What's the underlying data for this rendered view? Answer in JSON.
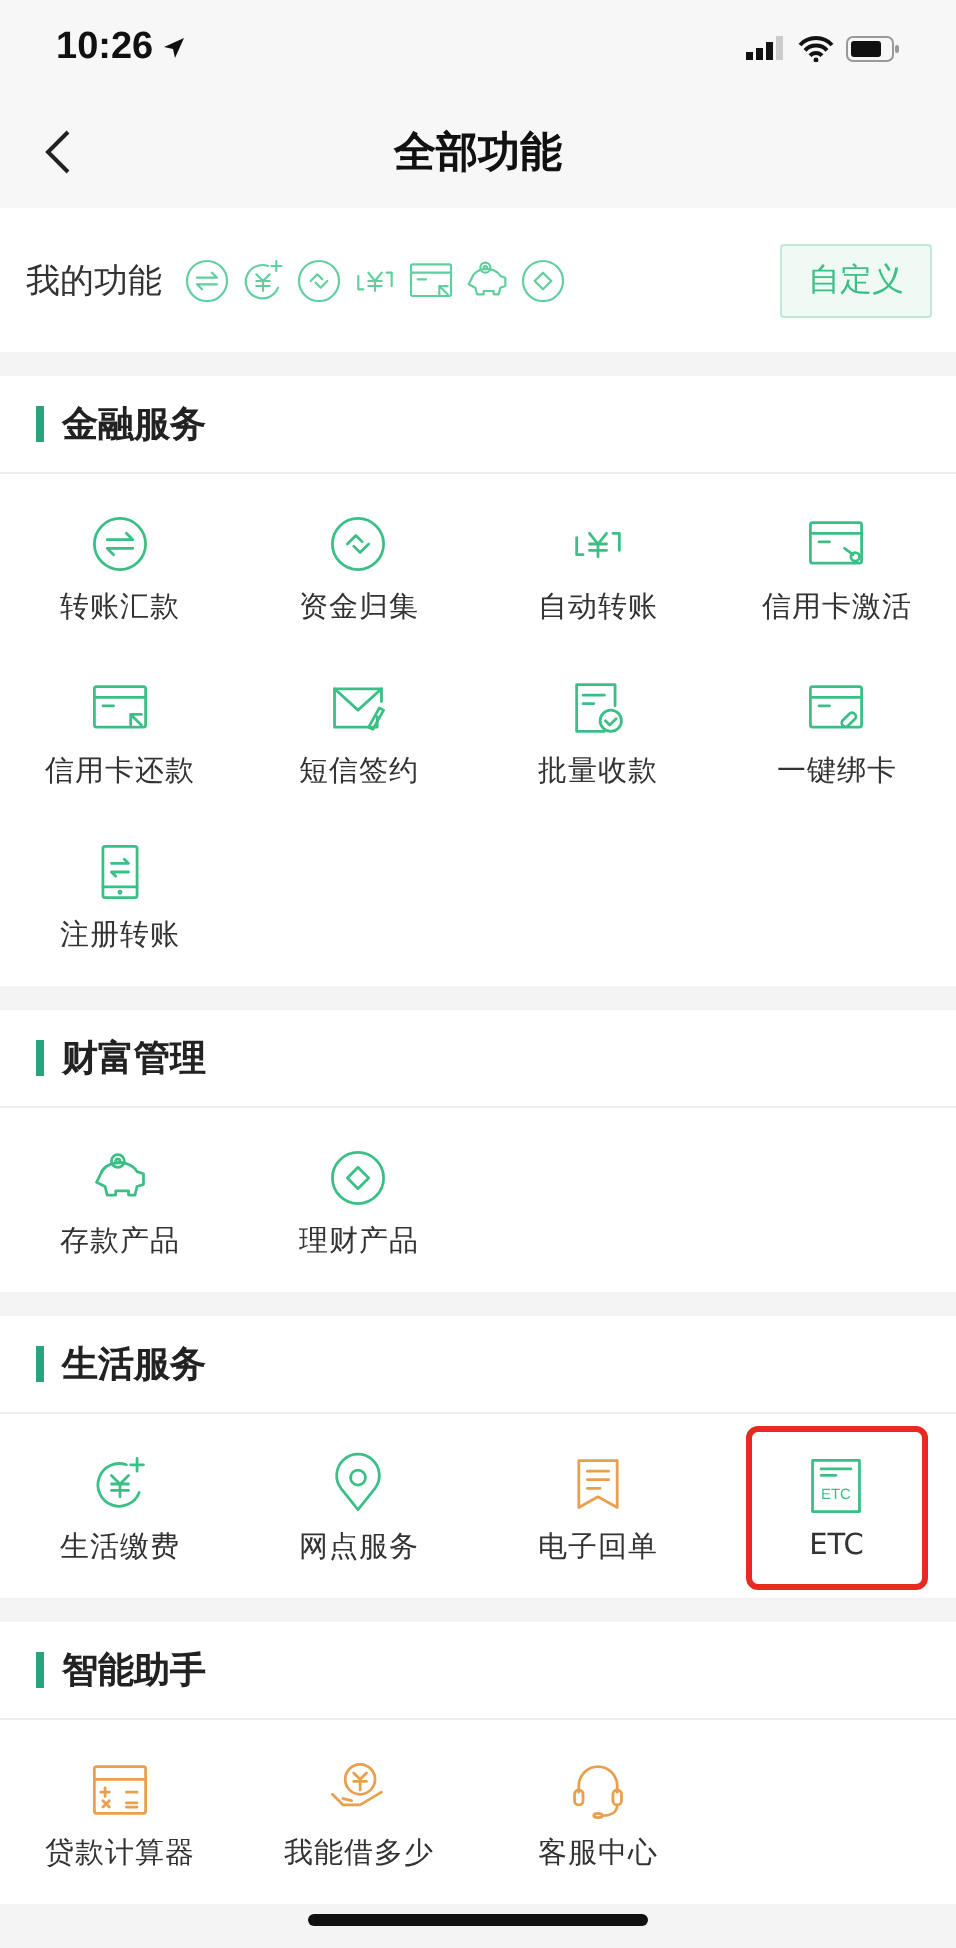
{
  "status_bar": {
    "time": "10:26"
  },
  "nav": {
    "title": "全部功能"
  },
  "my_functions": {
    "label": "我的功能",
    "icons": [
      {
        "kind": "transfer"
      },
      {
        "kind": "bill"
      },
      {
        "kind": "collect"
      },
      {
        "kind": "auto"
      },
      {
        "kind": "repay"
      },
      {
        "kind": "piggy"
      },
      {
        "kind": "wealth"
      }
    ],
    "button": "自定义"
  },
  "sections": [
    {
      "title": "金融服务",
      "items": [
        {
          "label": "转账汇款",
          "kind": "transfer",
          "color": "#3cbf87",
          "highlighted": false
        },
        {
          "label": "资金归集",
          "kind": "collect",
          "color": "#3cbf87",
          "highlighted": false
        },
        {
          "label": "自动转账",
          "kind": "auto",
          "color": "#3cbf87",
          "highlighted": false
        },
        {
          "label": "信用卡激活",
          "kind": "activate",
          "color": "#3cbf87",
          "highlighted": false
        },
        {
          "label": "信用卡还款",
          "kind": "repay",
          "color": "#3cbf87",
          "highlighted": false
        },
        {
          "label": "短信签约",
          "kind": "sms",
          "color": "#3cbf87",
          "highlighted": false
        },
        {
          "label": "批量收款",
          "kind": "batch",
          "color": "#3cbf87",
          "highlighted": false
        },
        {
          "label": "一键绑卡",
          "kind": "bind",
          "color": "#3cbf87",
          "highlighted": false
        },
        {
          "label": "注册转账",
          "kind": "register",
          "color": "#3cbf87",
          "highlighted": false
        }
      ]
    },
    {
      "title": "财富管理",
      "items": [
        {
          "label": "存款产品",
          "kind": "piggy",
          "color": "#3cbf87",
          "highlighted": false
        },
        {
          "label": "理财产品",
          "kind": "wealth",
          "color": "#3cbf87",
          "highlighted": false
        }
      ]
    },
    {
      "title": "生活服务",
      "items": [
        {
          "label": "生活缴费",
          "kind": "bill",
          "color": "#3cbf87",
          "highlighted": false
        },
        {
          "label": "网点服务",
          "kind": "location",
          "color": "#3cbf87",
          "highlighted": false
        },
        {
          "label": "电子回单",
          "kind": "receipt",
          "color": "#e9a04e",
          "highlighted": false
        },
        {
          "label": "ETC",
          "kind": "etc",
          "icon_text": "ETC",
          "color": "#3cbf87",
          "highlighted": true
        }
      ]
    },
    {
      "title": "智能助手",
      "items": [
        {
          "label": "贷款计算器",
          "kind": "calculator",
          "color": "#e9a04e",
          "highlighted": false
        },
        {
          "label": "我能借多少",
          "kind": "loan",
          "color": "#e9a04e",
          "highlighted": false
        },
        {
          "label": "客服中心",
          "kind": "service",
          "color": "#e9a04e",
          "highlighted": false
        }
      ]
    }
  ]
}
